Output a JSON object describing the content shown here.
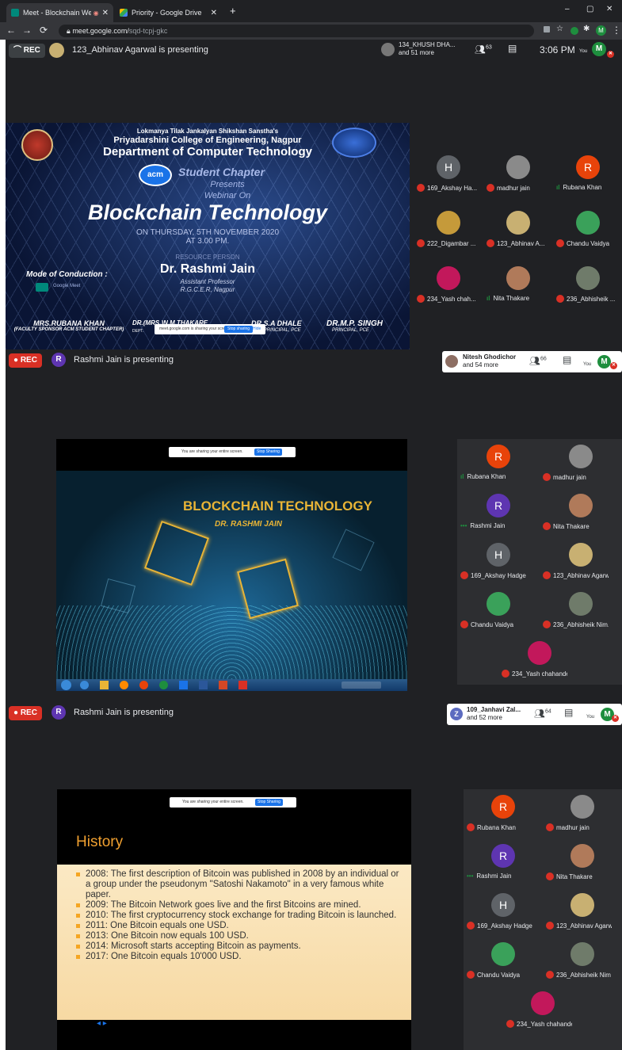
{
  "browser": {
    "tabs": [
      {
        "title": "Meet - Blockchain Webinar",
        "active": true
      },
      {
        "title": "Priority - Google Drive",
        "active": false
      }
    ],
    "new_tab": "+",
    "url_host": "meet.google.com/",
    "url_path": "sqd-tcpj-gkc",
    "window_controls": [
      "–",
      "▢",
      "✕"
    ]
  },
  "section1": {
    "rec": "REC",
    "presenter_text": "123_Abhinav Agarwal is presenting",
    "top_participant_line1": "134_KHUSH DHA...",
    "top_participant_line2": "and 51 more",
    "people_count": "63",
    "clock": "3:06 PM",
    "you_label": "You",
    "self_avatar": "M",
    "slide": {
      "sanstha": "Lokmanya Tilak Jankalyan Shikshan Sanstha's",
      "college": "Priyadarshini College of Engineering, Nagpur",
      "department": "Department of Computer Technology",
      "acm": "acm",
      "chapter": "Student Chapter",
      "presents": "Presents",
      "webinar_on": "Webinar On",
      "title": "Blockchain Technology",
      "date_line1": "ON THURSDAY, 5TH NOVEMBER 2020",
      "date_line2": "AT 3.00 PM.",
      "resource": "RESOURCE PERSON",
      "speaker": "Dr. Rashmi Jain",
      "speaker_title": "Assistant Professor",
      "speaker_org": "R.G.C.E.R, Nagpur",
      "mode": "Mode of Conduction :",
      "mode_app": "Google Meet",
      "p1_name": "MRS.RUBANA KHAN",
      "p1_role": "(FACULTY SPONSOR ACM STUDENT CHAPTER)",
      "p2_name": "DR.(MRS.)N.M.THAKARE",
      "p2_role": "DEPT.",
      "p3_name": "DR.S.A DHALE",
      "p3_role": "VICE PRINCIPAL, PCE",
      "p4_name": "DR.M.P. SINGH",
      "p4_role": "PRINCIPAL, PCE",
      "share_text": "meet.google.com is sharing your screen.",
      "stop_sharing": "Stop sharing",
      "hide": "Hide"
    },
    "tiles": [
      {
        "name": "169_Akshay Ha...",
        "avatar": "H",
        "color": "#5f6368",
        "mic": "muted"
      },
      {
        "name": "madhur jain",
        "avatar": "",
        "color": "#8a8a8a",
        "mic": "muted"
      },
      {
        "name": "Rubana Khan",
        "avatar": "R",
        "color": "#e8430a",
        "mic": "speaking"
      },
      {
        "name": "222_Digambar ...",
        "avatar": "",
        "color": "#c59a3a",
        "mic": "muted"
      },
      {
        "name": "123_Abhinav A...",
        "avatar": "",
        "color": "#c8b072",
        "mic": "muted"
      },
      {
        "name": "Chandu Vaidya",
        "avatar": "",
        "color": "#3aa15a",
        "mic": "muted"
      },
      {
        "name": "234_Yash chah...",
        "avatar": "",
        "color": "#c2185b",
        "mic": "muted"
      },
      {
        "name": "Nita Thakare",
        "avatar": "",
        "color": "#b07a5a",
        "mic": "speaking"
      },
      {
        "name": "236_Abhisheik ...",
        "avatar": "",
        "color": "#6f7b6a",
        "mic": "muted"
      }
    ]
  },
  "section2": {
    "rec": "REC",
    "presenter_avatar": "R",
    "presenter_text": "Rashmi Jain is presenting",
    "top_participant_line1": "Nitesh Ghodichor",
    "top_participant_line2": "and 54 more",
    "people_count": "66",
    "you_label": "You",
    "self_avatar": "M",
    "share_text": "You are sharing your entire screen.",
    "stop_sharing": "Stop Sharing",
    "slide_title": "BLOCKCHAIN TECHNOLOGY",
    "slide_author": "DR. RASHMI JAIN",
    "tiles": [
      {
        "name": "Rubana Khan",
        "avatar": "R",
        "color": "#e8430a",
        "mic": "speaking"
      },
      {
        "name": "madhur jain",
        "avatar": "",
        "color": "#8a8a8a",
        "mic": "muted"
      },
      {
        "name": "Rashmi Jain",
        "avatar": "R",
        "color": "#5e35b1",
        "mic": "dots"
      },
      {
        "name": "Nita Thakare",
        "avatar": "",
        "color": "#b07a5a",
        "mic": "muted"
      },
      {
        "name": "169_Akshay Hadge",
        "avatar": "H",
        "color": "#5f6368",
        "mic": "muted"
      },
      {
        "name": "123_Abhinav Agarw...",
        "avatar": "",
        "color": "#c8b072",
        "mic": "muted"
      },
      {
        "name": "Chandu Vaidya",
        "avatar": "",
        "color": "#3aa15a",
        "mic": "muted"
      },
      {
        "name": "236_Abhisheik Nim...",
        "avatar": "",
        "color": "#6f7b6a",
        "mic": "muted"
      },
      {
        "name": "234_Yash chahande",
        "avatar": "",
        "color": "#c2185b",
        "mic": "muted"
      }
    ]
  },
  "section3": {
    "rec": "REC",
    "presenter_avatar": "R",
    "presenter_text": "Rashmi Jain is presenting",
    "top_avatar": "Z",
    "top_participant_line1": "109_Janhavi Zal...",
    "top_participant_line2": "and 52 more",
    "people_count": "64",
    "you_label": "You",
    "self_avatar": "M",
    "share_text": "You are sharing your entire screen.",
    "stop_sharing": "Stop Sharing",
    "slide_title": "History",
    "history": [
      "2008: The first description of Bitcoin was published in 2008 by an individual or a group under the pseudonym \"Satoshi Nakamoto\" in a very famous white paper.",
      "2009: The Bitcoin Network goes live and the first Bitcoins are mined.",
      "2010: The first cryptocurrency stock exchange for trading Bitcoin is launched.",
      "2011: One Bitcoin equals one USD.",
      "2013: One Bitcoin now equals 100 USD.",
      "2014: Microsoft starts accepting Bitcoin as payments.",
      "2017: One Bitcoin equals 10'000 USD."
    ],
    "tiles": [
      {
        "name": "Rubana Khan",
        "avatar": "R",
        "color": "#e8430a",
        "mic": "muted"
      },
      {
        "name": "madhur jain",
        "avatar": "",
        "color": "#8a8a8a",
        "mic": "muted"
      },
      {
        "name": "Rashmi Jain",
        "avatar": "R",
        "color": "#5e35b1",
        "mic": "dots"
      },
      {
        "name": "Nita Thakare",
        "avatar": "",
        "color": "#b07a5a",
        "mic": "muted"
      },
      {
        "name": "169_Akshay Hadge",
        "avatar": "H",
        "color": "#5f6368",
        "mic": "muted"
      },
      {
        "name": "123_Abhinav Agarw",
        "avatar": "",
        "color": "#c8b072",
        "mic": "muted"
      },
      {
        "name": "Chandu Vaidya",
        "avatar": "",
        "color": "#3aa15a",
        "mic": "muted"
      },
      {
        "name": "236_Abhisheik Nim",
        "avatar": "",
        "color": "#6f7b6a",
        "mic": "muted"
      },
      {
        "name": "234_Yash chahande",
        "avatar": "",
        "color": "#c2185b",
        "mic": "muted"
      }
    ]
  },
  "colors": {
    "meet_bg": "#202124",
    "rec_red": "#d93025",
    "accent_blue": "#1a73e8",
    "slide_gold": "#e8b436"
  }
}
